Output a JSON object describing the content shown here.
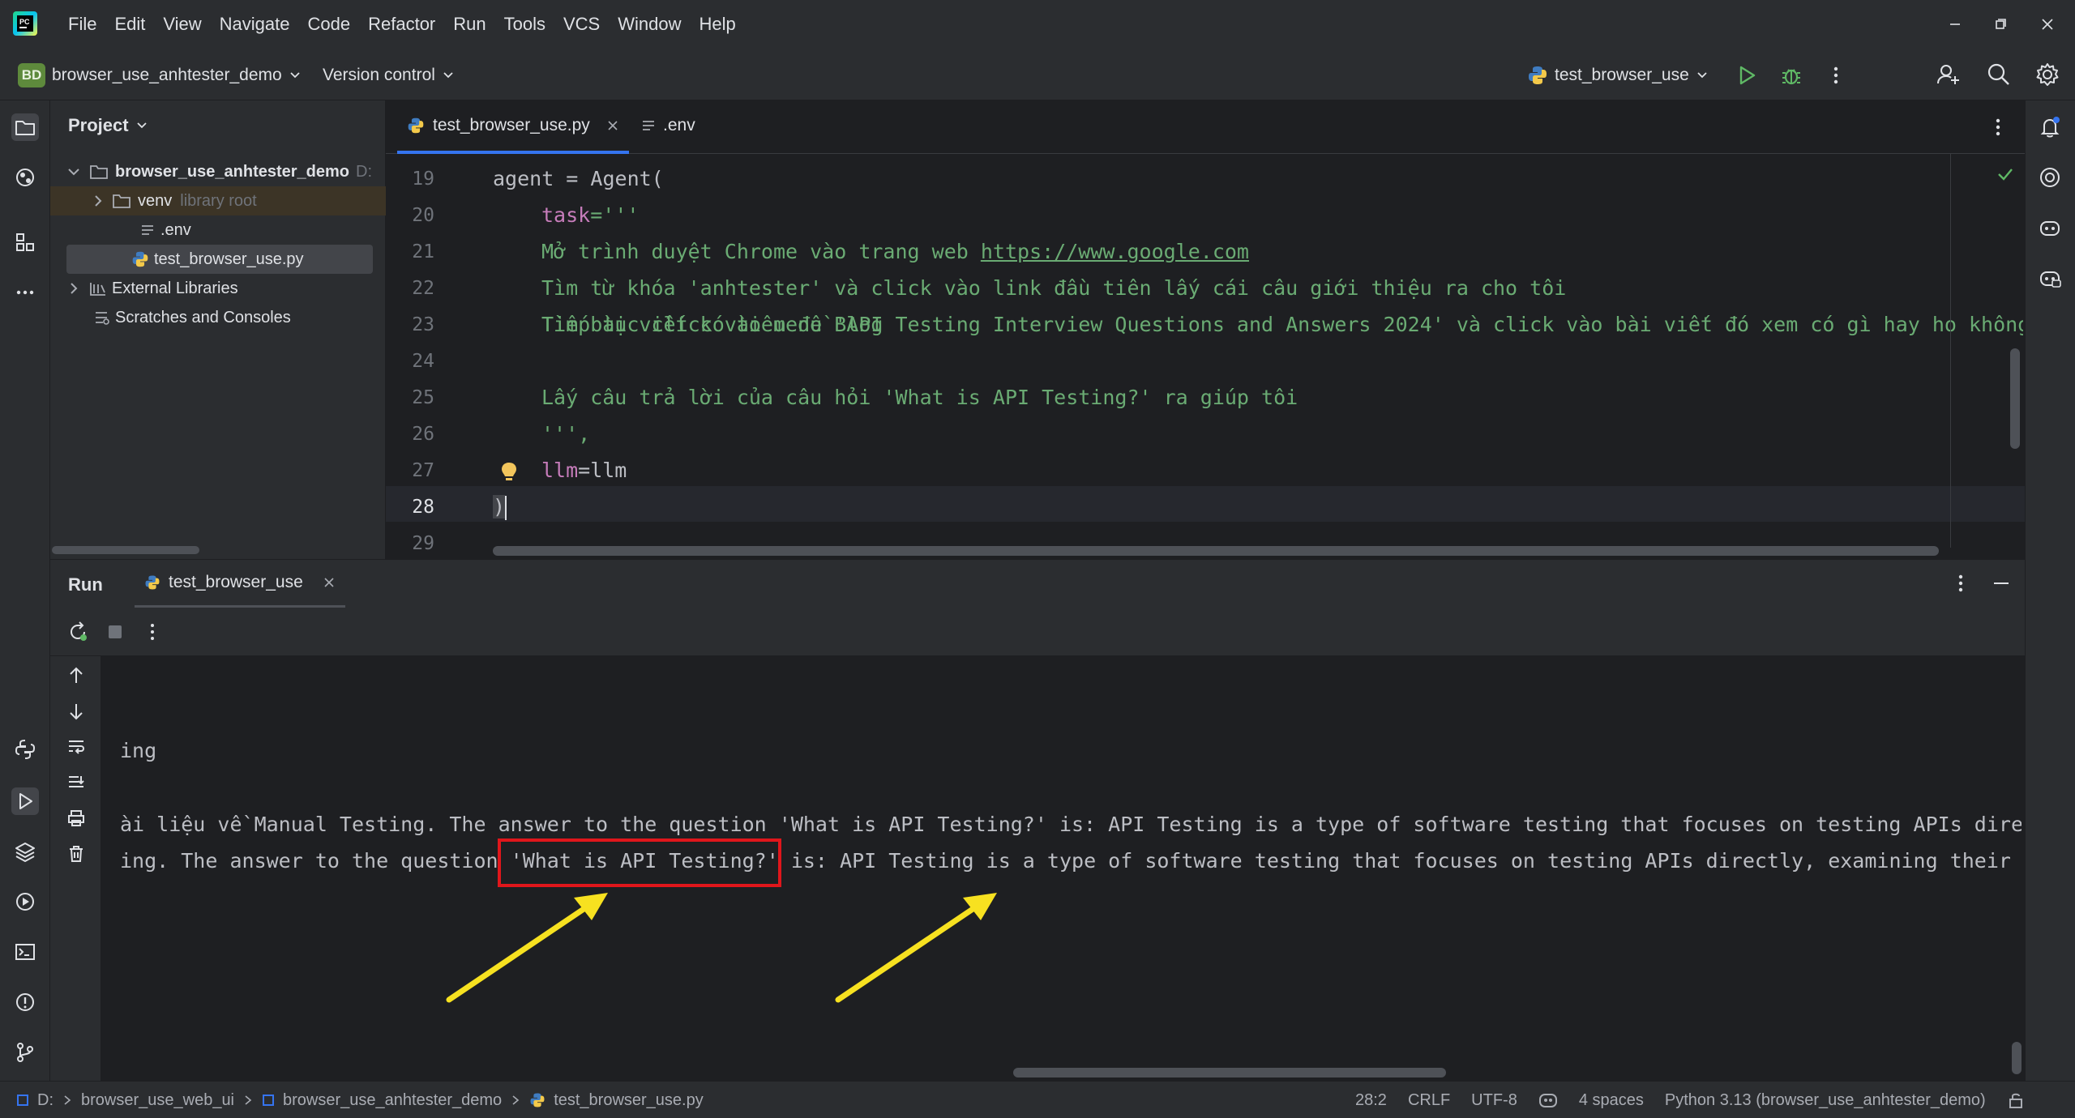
{
  "menubar": {
    "items": [
      "File",
      "Edit",
      "View",
      "Navigate",
      "Code",
      "Refactor",
      "Run",
      "Tools",
      "VCS",
      "Window",
      "Help"
    ]
  },
  "toolbar": {
    "project_badge": "BD",
    "project_name": "browser_use_anhtester_demo",
    "version_control": "Version control",
    "run_config": "test_browser_use"
  },
  "project_panel": {
    "title": "Project",
    "root": "browser_use_anhtester_demo",
    "root_suffix": "D:",
    "venv": "venv",
    "venv_note": "library root",
    "env_file": ".env",
    "py_file": "test_browser_use.py",
    "external": "External Libraries",
    "scratches": "Scratches and Consoles"
  },
  "editor": {
    "tabs": [
      {
        "label": "test_browser_use.py",
        "active": true
      },
      {
        "label": ".env",
        "active": false
      }
    ],
    "line_numbers": [
      "19",
      "20",
      "21",
      "22",
      "23",
      "24",
      "25",
      "26",
      "27",
      "28",
      "29"
    ],
    "lines": {
      "l19": "agent = Agent(",
      "l20_param": "task",
      "l20_rest": "='''",
      "l21_text": "Mở trình duyệt Chrome vào trang web ",
      "l21_link": "https://www.google.com",
      "l22": "Tìm từ khóa 'anhtester' và click vào link đầu tiên lấy cái câu giới thiệu ra cho tôi",
      "l23": "Tiếp tục click vào menu Blog",
      "l24": "Tìm bài viết có tiêu đề 'API Testing Interview Questions and Answers 2024' và click vào bài viết đó xem có gì hay ho không",
      "l25": "Lấy câu trả lời của câu hỏi 'What is API Testing?' ra giúp tôi",
      "l26": "''',",
      "l27_param": "llm",
      "l27_rest": "=llm",
      "l28": ")"
    }
  },
  "run_panel": {
    "title": "Run",
    "tab": "test_browser_use",
    "console": {
      "line1": "ing",
      "line2": "ài liệu về Manual Testing. The answer to the question 'What is API Testing?' is: API Testing is a type of software testing that focuses on testing APIs direc",
      "line3_pre": "ing. The answer to the question ",
      "line3_box": "'What is API Testing?'",
      "line3_post": " is: API Testing is a type of software testing that focuses on testing APIs directly, examining their f"
    }
  },
  "statusbar": {
    "crumbs": [
      "D:",
      "browser_use_web_ui",
      "browser_use_anhtester_demo",
      "test_browser_use.py"
    ],
    "position": "28:2",
    "line_sep": "CRLF",
    "encoding": "UTF-8",
    "indent": "4 spaces",
    "interpreter": "Python 3.13 (browser_use_anhtester_demo)"
  },
  "colors": {
    "accent": "#3574f0",
    "run_green": "#5fb865",
    "annotation_red": "#e0161b",
    "annotation_yellow": "#f7e120"
  }
}
